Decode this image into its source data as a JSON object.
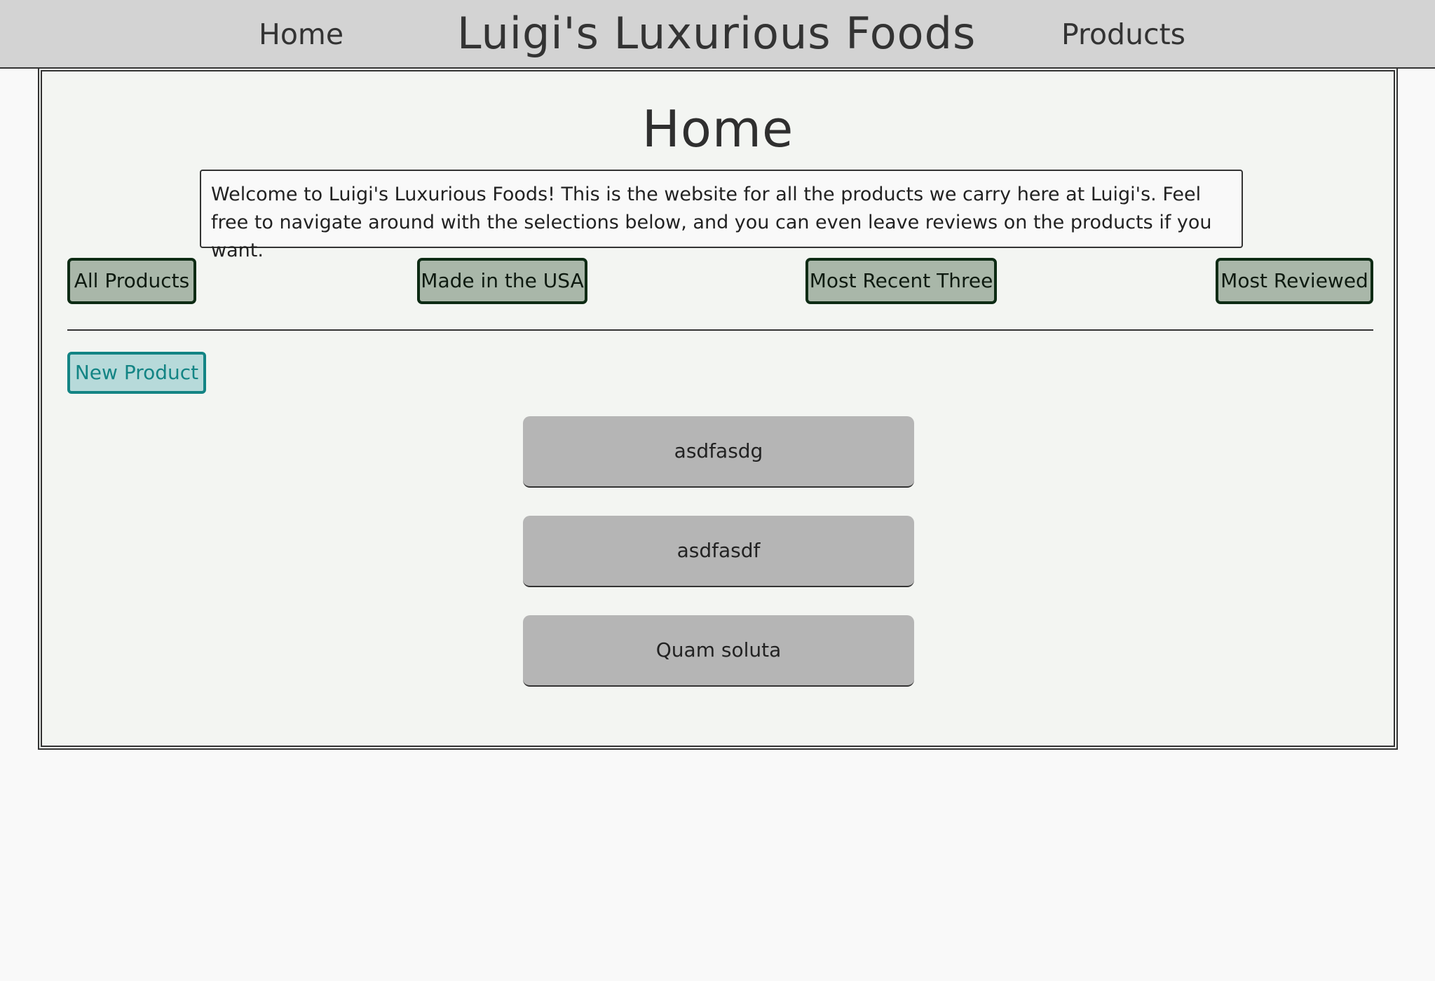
{
  "nav": {
    "home_label": "Home",
    "brand": "Luigi's Luxurious Foods",
    "products_label": "Products"
  },
  "page": {
    "title": "Home",
    "intro": "Welcome to Luigi's Luxurious Foods! This is the website for all the products we carry here at Luigi's. Feel free to navigate around with the selections below, and you can even leave reviews on the products if you want."
  },
  "filters": {
    "all_products": "All Products",
    "made_in_usa": "Made in the USA",
    "most_recent_three": "Most Recent Three",
    "most_reviewed": "Most Reviewed"
  },
  "new_product_label": "New Product",
  "products": [
    {
      "name": "asdfasdg"
    },
    {
      "name": "asdfasdf"
    },
    {
      "name": "Quam soluta"
    }
  ],
  "colors": {
    "nav_bg": "#d3d3d3",
    "filter_bg": "#a9b7a9",
    "new_product_accent": "#138484",
    "product_card_bg": "#b5b5b5"
  }
}
